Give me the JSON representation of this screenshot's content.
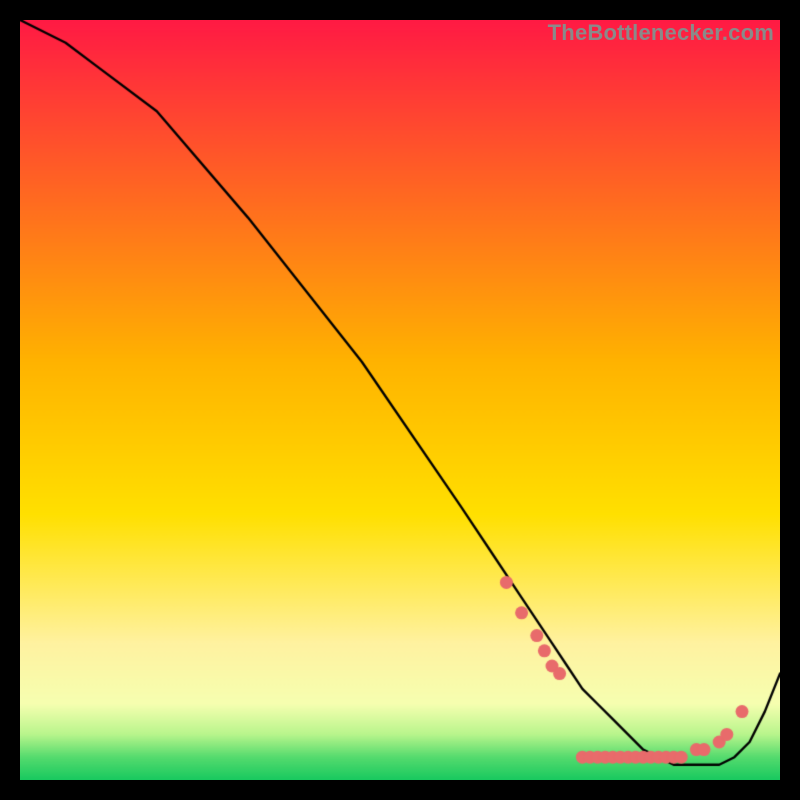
{
  "watermark": "TheBottlenecker.com",
  "colors": {
    "black": "#000000",
    "line": "#000000",
    "dot": "#e86b6b",
    "gradient_top": "#ff1a44",
    "gradient_mid": "#ffd400",
    "gradient_low": "#fff6b0",
    "gradient_bottom": "#18d66b"
  },
  "chart_data": {
    "type": "line",
    "title": "",
    "xlabel": "",
    "ylabel": "",
    "xlim": [
      0,
      100
    ],
    "ylim": [
      0,
      100
    ],
    "grid": false,
    "legend": false,
    "series": [
      {
        "name": "curve",
        "x": [
          0,
          6,
          10,
          18,
          30,
          45,
          58,
          62,
          66,
          70,
          72,
          74,
          76,
          78,
          80,
          82,
          84,
          86,
          88,
          90,
          92,
          94,
          96,
          98,
          100
        ],
        "y": [
          100,
          97,
          94,
          88,
          74,
          55,
          36,
          30,
          24,
          18,
          15,
          12,
          10,
          8,
          6,
          4,
          3,
          2,
          2,
          2,
          2,
          3,
          5,
          9,
          14
        ]
      }
    ],
    "dots": [
      {
        "x": 64,
        "y": 26
      },
      {
        "x": 66,
        "y": 22
      },
      {
        "x": 68,
        "y": 19
      },
      {
        "x": 69,
        "y": 17
      },
      {
        "x": 70,
        "y": 15
      },
      {
        "x": 71,
        "y": 14
      },
      {
        "x": 74,
        "y": 3
      },
      {
        "x": 75,
        "y": 3
      },
      {
        "x": 76,
        "y": 3
      },
      {
        "x": 77,
        "y": 3
      },
      {
        "x": 78,
        "y": 3
      },
      {
        "x": 79,
        "y": 3
      },
      {
        "x": 80,
        "y": 3
      },
      {
        "x": 81,
        "y": 3
      },
      {
        "x": 82,
        "y": 3
      },
      {
        "x": 83,
        "y": 3
      },
      {
        "x": 84,
        "y": 3
      },
      {
        "x": 85,
        "y": 3
      },
      {
        "x": 86,
        "y": 3
      },
      {
        "x": 87,
        "y": 3
      },
      {
        "x": 89,
        "y": 4
      },
      {
        "x": 90,
        "y": 4
      },
      {
        "x": 92,
        "y": 5
      },
      {
        "x": 93,
        "y": 6
      },
      {
        "x": 95,
        "y": 9
      }
    ],
    "gradient_stops": [
      {
        "pos": 0.0,
        "color": "#ff1a44"
      },
      {
        "pos": 0.45,
        "color": "#ffb300"
      },
      {
        "pos": 0.65,
        "color": "#ffe000"
      },
      {
        "pos": 0.82,
        "color": "#fff2a0"
      },
      {
        "pos": 0.9,
        "color": "#f6ffb0"
      },
      {
        "pos": 0.94,
        "color": "#b8f58c"
      },
      {
        "pos": 0.97,
        "color": "#55db6e"
      },
      {
        "pos": 1.0,
        "color": "#18c95f"
      }
    ]
  }
}
